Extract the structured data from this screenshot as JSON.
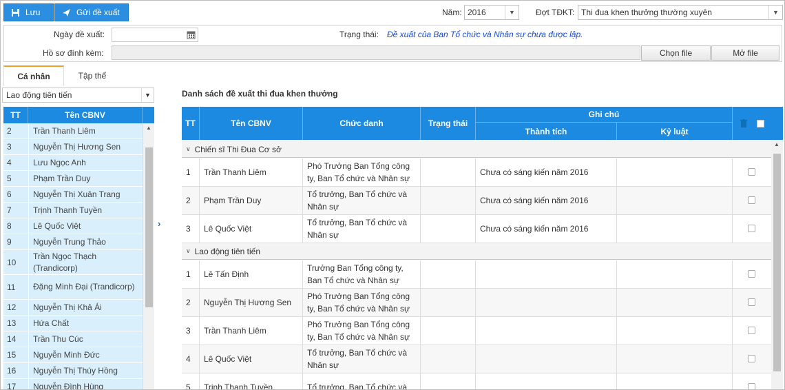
{
  "toolbar": {
    "save_label": "Lưu",
    "send_label": "Gửi đề xuất"
  },
  "filters": {
    "year_label": "Năm:",
    "year_value": "2016",
    "period_label": "Đợt TĐKT:",
    "period_value": "Thi đua khen thưởng thường xuyên"
  },
  "form": {
    "date_label": "Ngày đề xuất:",
    "date_value": "",
    "status_label": "Trạng thái:",
    "status_value": "Đề xuất của Ban Tổ chức và Nhân sự chưa được lập.",
    "attach_label": "Hồ sơ đính kèm:",
    "attach_value": "",
    "choose_file": "Chọn file",
    "open_file": "Mở file"
  },
  "tabs": [
    {
      "label": "Cá nhân"
    },
    {
      "label": "Tập thể"
    }
  ],
  "left": {
    "category": "Lao động tiên tiến",
    "col_tt": "TT",
    "col_name": "Tên CBNV",
    "rows": [
      {
        "tt": "2",
        "name": "Trần Thanh Liêm"
      },
      {
        "tt": "3",
        "name": "Nguyễn Thị Hương Sen"
      },
      {
        "tt": "4",
        "name": "Lưu Ngọc Anh"
      },
      {
        "tt": "5",
        "name": "Phạm Trần Duy"
      },
      {
        "tt": "6",
        "name": "Nguyễn Thị Xuân Trang"
      },
      {
        "tt": "7",
        "name": "Trịnh Thanh Tuyền"
      },
      {
        "tt": "8",
        "name": "Lê Quốc Việt"
      },
      {
        "tt": "9",
        "name": "Nguyễn Trung Thảo"
      },
      {
        "tt": "10",
        "name": "Trần Ngọc Thạch (Trandicorp)"
      },
      {
        "tt": "11",
        "name": "Đặng Minh Đại (Trandicorp)"
      },
      {
        "tt": "12",
        "name": "Nguyễn Thị Khả Ái"
      },
      {
        "tt": "13",
        "name": "Hứa Chất"
      },
      {
        "tt": "14",
        "name": "Trần Thu Cúc"
      },
      {
        "tt": "15",
        "name": "Nguyễn Minh Đức"
      },
      {
        "tt": "16",
        "name": "Nguyễn Thị Thúy Hồng"
      },
      {
        "tt": "17",
        "name": "Nguyễn Đình Hùng"
      }
    ]
  },
  "right": {
    "title": "Danh sách đề xuất thi đua khen thưởng",
    "headers": {
      "tt": "TT",
      "name": "Tên CBNV",
      "position": "Chức danh",
      "status": "Trạng thái",
      "note": "Ghi chú",
      "achievement": "Thành tích",
      "discipline": "Kỷ luật"
    },
    "groups": [
      {
        "title": "Chiến sĩ Thi Đua Cơ sở",
        "rows": [
          {
            "tt": "1",
            "name": "Trần Thanh Liêm",
            "position": "Phó Trưởng Ban Tổng công ty, Ban Tổ chức và Nhân sự",
            "status": "",
            "achievement": "Chưa có sáng kiến năm 2016",
            "discipline": ""
          },
          {
            "tt": "2",
            "name": "Phạm Trần Duy",
            "position": "Tổ trưởng, Ban Tổ chức và Nhân sự",
            "status": "",
            "achievement": "Chưa có sáng kiến năm 2016",
            "discipline": ""
          },
          {
            "tt": "3",
            "name": "Lê Quốc Việt",
            "position": "Tổ trưởng, Ban Tổ chức và Nhân sự",
            "status": "",
            "achievement": "Chưa có sáng kiến năm 2016",
            "discipline": ""
          }
        ]
      },
      {
        "title": "Lao động tiên tiến",
        "rows": [
          {
            "tt": "1",
            "name": "Lê Tấn Định",
            "position": "Trưởng Ban Tổng công ty, Ban Tổ chức và Nhân sự",
            "status": "",
            "achievement": "",
            "discipline": ""
          },
          {
            "tt": "2",
            "name": "Nguyễn Thị Hương Sen",
            "position": "Phó Trưởng Ban Tổng công ty, Ban Tổ chức và Nhân sự",
            "status": "",
            "achievement": "",
            "discipline": ""
          },
          {
            "tt": "3",
            "name": "Trần Thanh Liêm",
            "position": "Phó Trưởng Ban Tổng công ty, Ban Tổ chức và Nhân sự",
            "status": "",
            "achievement": "",
            "discipline": ""
          },
          {
            "tt": "4",
            "name": "Lê Quốc Việt",
            "position": "Tổ trưởng, Ban Tổ chức và Nhân sự",
            "status": "",
            "achievement": "",
            "discipline": ""
          },
          {
            "tt": "5",
            "name": "Trịnh Thanh Tuyền",
            "position": "Tổ trưởng, Ban Tổ chức và",
            "status": "",
            "achievement": "",
            "discipline": ""
          }
        ]
      }
    ]
  }
}
